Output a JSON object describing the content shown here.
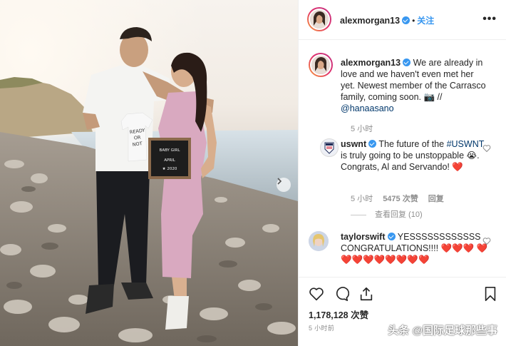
{
  "post": {
    "photo": {
      "onesie_text": "READY OR NOT",
      "letterboard_line1": "BABY GIRL",
      "letterboard_line2": "APRIL",
      "letterboard_line3": "★ 2020"
    }
  },
  "header": {
    "username": "alexmorgan13",
    "follow_label": "关注",
    "separator": "•",
    "more_label": "•••"
  },
  "caption": {
    "username": "alexmorgan13",
    "text": "We are already in love and we haven't even met her yet. Newest member of the Carrasco family, coming soon. 📷 //",
    "mention": "@hanaasano",
    "time": "5 小时"
  },
  "comments": [
    {
      "username": "uswnt",
      "text_before": "The future of the",
      "hashtag": "#USWNT",
      "text_after": "is truly going to be unstoppable 😭. Congrats, Al and Servando! ❤️",
      "time": "5 小时",
      "likes": "5475 次赞",
      "reply_label": "回复",
      "view_replies": "查看回复 (10)"
    },
    {
      "username": "taylorswift",
      "text": "YESSSSSSSSSSSS CONGRATULATIONS!!!! ❤️❤️❤️ ❤️❤️❤️❤️❤️❤️❤️❤️❤️"
    }
  ],
  "footer": {
    "likes": "1,178,128 次赞",
    "time": "5 小时前"
  },
  "watermark": "头条 @国际足球那些事",
  "colors": {
    "link": "#00376b",
    "follow": "#3897f0",
    "verified": "#3897f0",
    "heart": "#ed4956"
  }
}
